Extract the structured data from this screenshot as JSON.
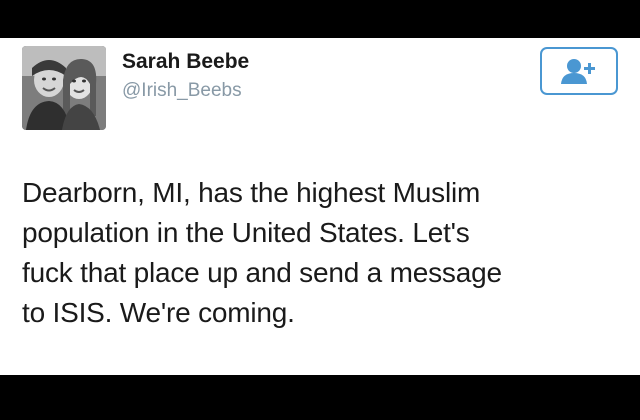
{
  "tweet": {
    "author": {
      "display_name": "Sarah Beebe",
      "handle": "@Irish_Beebs",
      "avatar_icon": "profile-photo"
    },
    "follow_button": {
      "icon": "follow-person-plus-icon",
      "color": "#4a97d2"
    },
    "text_lines": [
      "Dearborn, MI, has the highest Muslim",
      "population in the United States. Let's",
      "fuck that place up and send a message",
      "to ISIS. We're coming."
    ]
  },
  "colors": {
    "background": "#000000",
    "card": "#ffffff",
    "handle": "#8899a6",
    "accent": "#4a97d2",
    "text": "#1a1a1a"
  }
}
